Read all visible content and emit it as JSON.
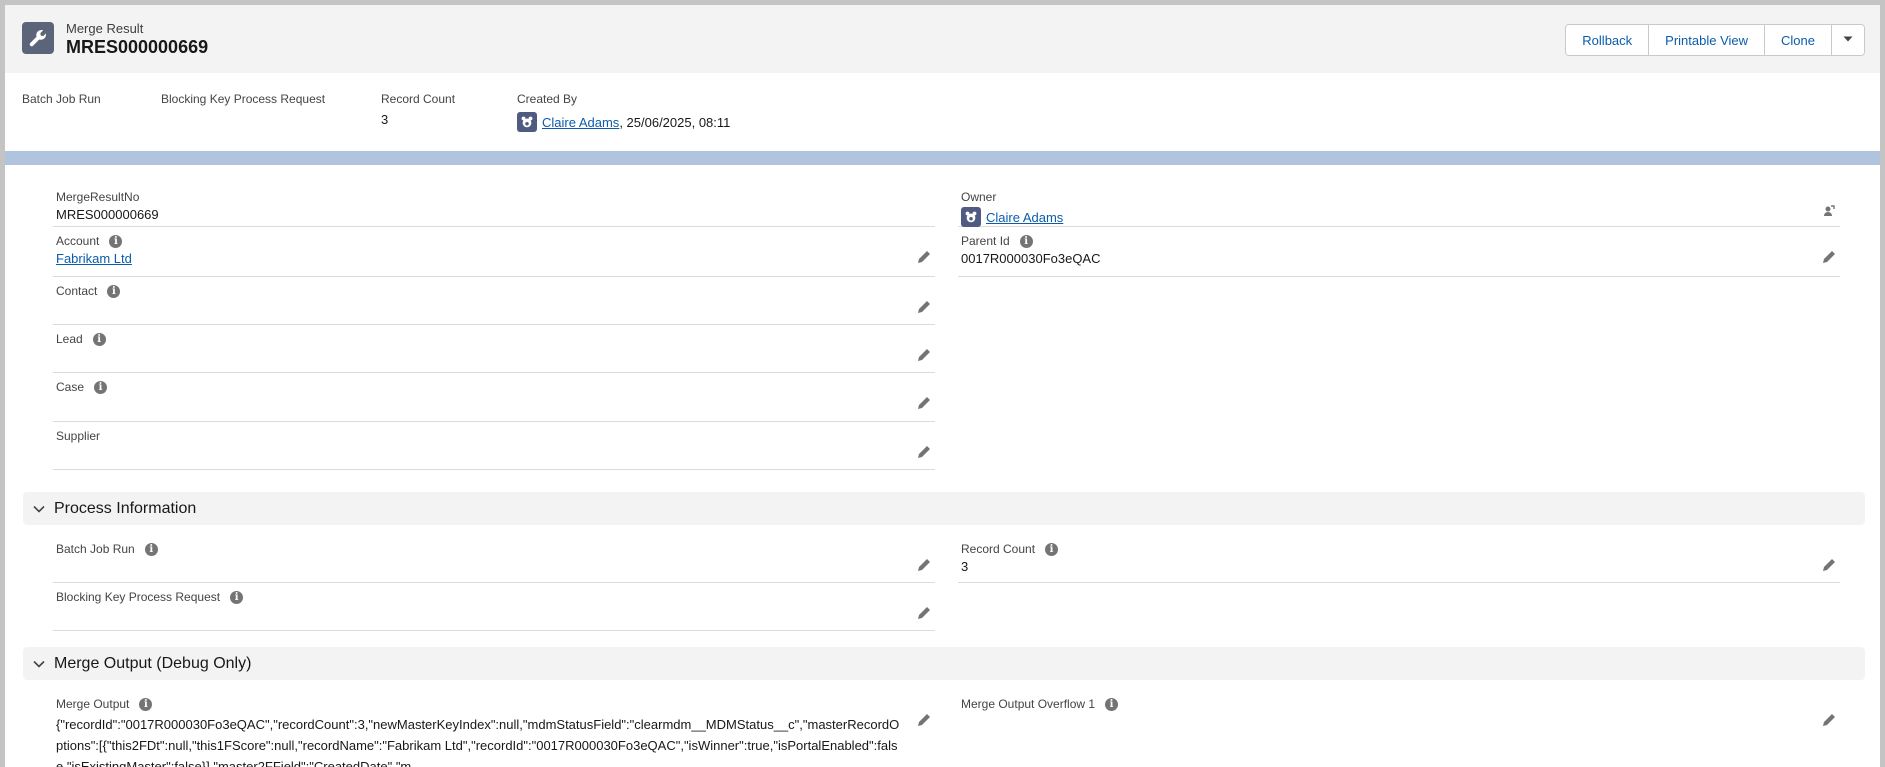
{
  "header": {
    "object_type": "Merge Result",
    "record_name": "MRES000000669",
    "buttons": [
      "Rollback",
      "Printable View",
      "Clone"
    ]
  },
  "highlights": {
    "batch_job_run_label": "Batch Job Run",
    "blocking_key_label": "Blocking Key Process Request",
    "record_count_label": "Record Count",
    "record_count_value": "3",
    "created_by_label": "Created By",
    "created_by_user": "Claire Adams",
    "created_by_date": ", 25/06/2025, 08:11"
  },
  "details": {
    "merge_result_no_label": "MergeResultNo",
    "merge_result_no_value": "MRES000000669",
    "owner_label": "Owner",
    "owner_value": "Claire Adams",
    "account_label": "Account",
    "account_value": "Fabrikam Ltd",
    "parent_id_label": "Parent Id",
    "parent_id_value": "0017R000030Fo3eQAC",
    "contact_label": "Contact",
    "lead_label": "Lead",
    "case_label": "Case",
    "supplier_label": "Supplier"
  },
  "process_section": {
    "title": "Process Information",
    "batch_job_run_label": "Batch Job Run",
    "record_count_label": "Record Count",
    "record_count_value": "3",
    "blocking_key_label": "Blocking Key Process Request"
  },
  "merge_section": {
    "title": "Merge Output (Debug Only)",
    "merge_output_label": "Merge Output",
    "merge_output_value": "{\"recordId\":\"0017R000030Fo3eQAC\",\"recordCount\":3,\"newMasterKeyIndex\":null,\"mdmStatusField\":\"clearmdm__MDMStatus__c\",\"masterRecordOptions\":[{\"this2FDt\":null,\"this1FScore\":null,\"recordName\":\"Fabrikam Ltd\",\"recordId\":\"0017R000030Fo3eQAC\",\"isWinner\":true,\"isPortalEnabled\":false,\"isExistingMaster\":false}],\"master2FField\":\"CreatedDate\",\"m",
    "overflow_label": "Merge Output Overflow 1"
  },
  "colors": {
    "link": "#0b5cab",
    "header_bg": "#f3f3f3",
    "band": "#b0c4df",
    "icon_bg": "#5b6478"
  },
  "icons": {
    "object": "wrench-icon",
    "dropdown": "chevron-down-icon",
    "edit": "pencil-icon",
    "info": "info-icon",
    "change_owner": "change-owner-icon",
    "collapse": "chevron-down-icon"
  }
}
